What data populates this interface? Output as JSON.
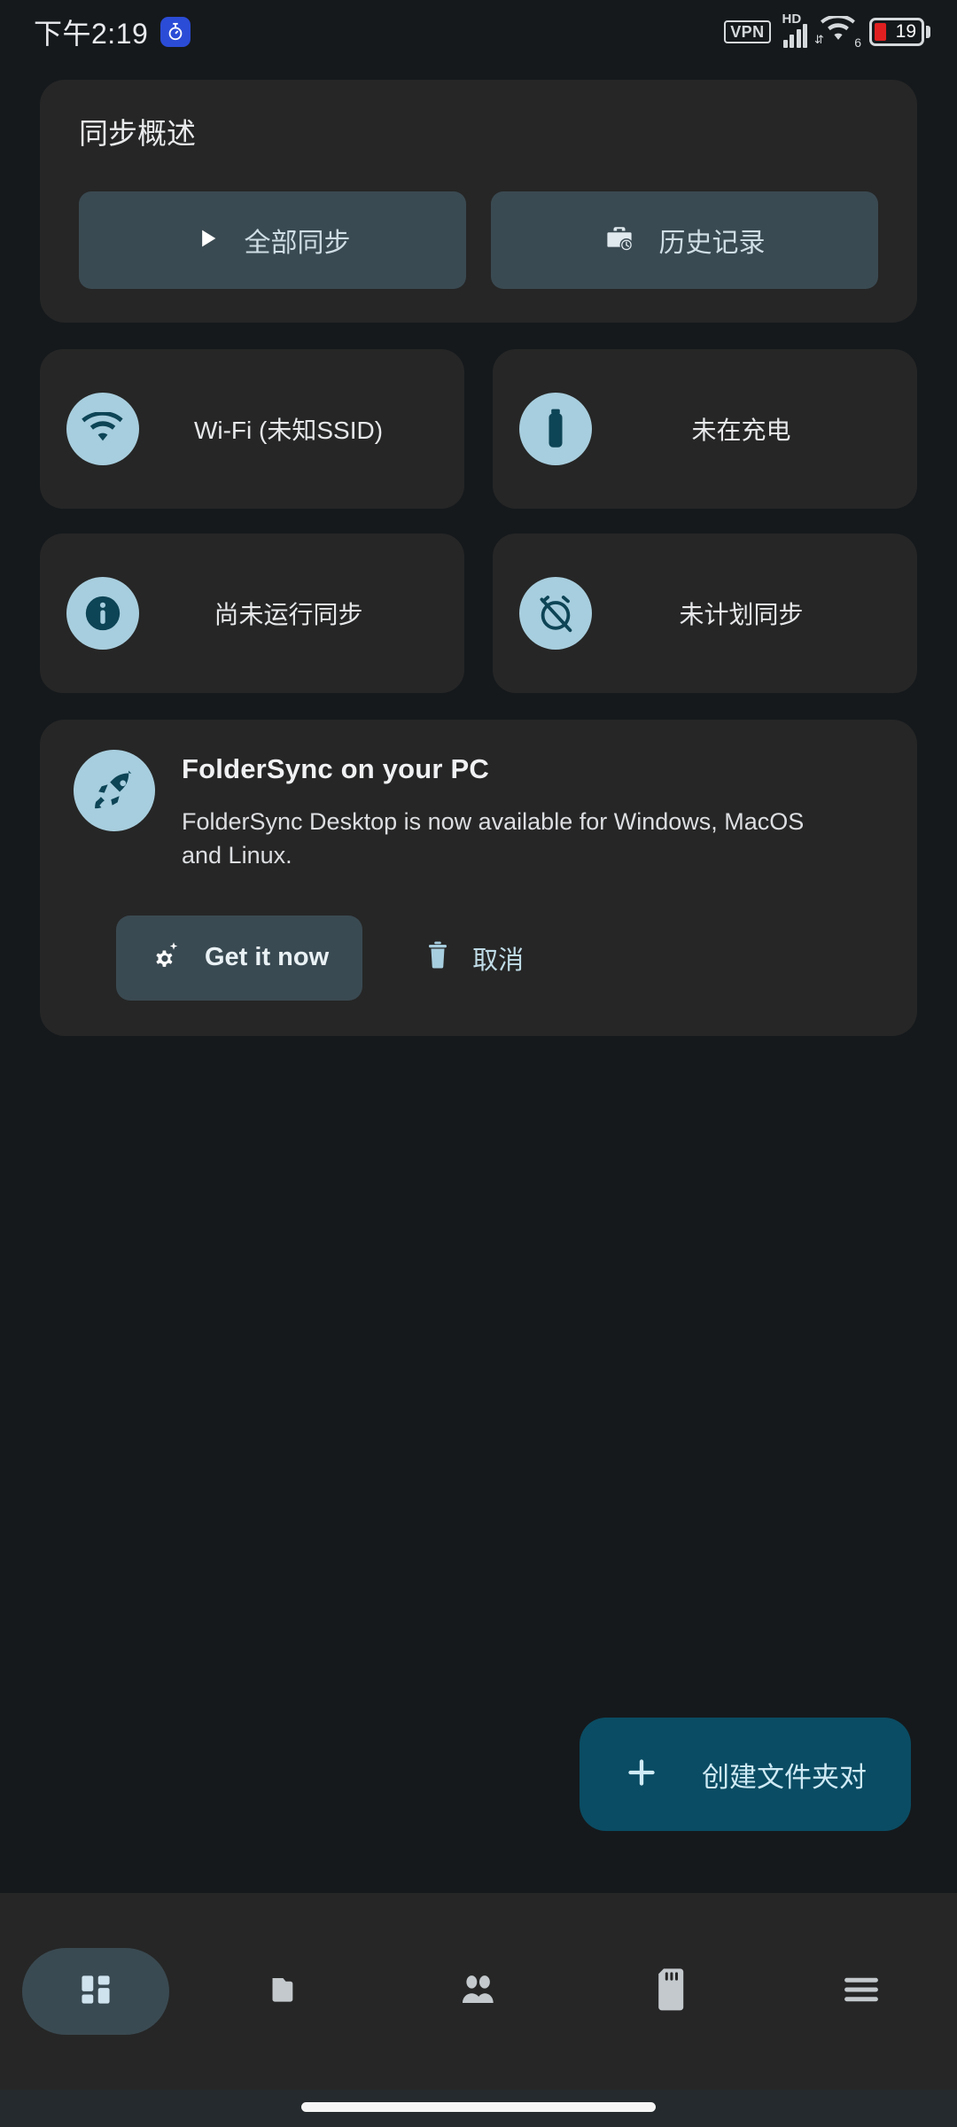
{
  "status_bar": {
    "clock": "下午2:19",
    "notification_icon": "stopwatch-icon",
    "vpn_label": "VPN",
    "hd_label": "HD",
    "wifi_generation": "6",
    "battery_percent": "19"
  },
  "overview": {
    "title": "同步概述",
    "buttons": [
      {
        "label": "全部同步",
        "icon": "play-icon"
      },
      {
        "label": "历史记录",
        "icon": "history-briefcase-icon"
      }
    ]
  },
  "tiles": [
    {
      "label": "Wi-Fi (未知SSID)",
      "icon": "wifi-icon"
    },
    {
      "label": "未在充电",
      "icon": "battery-icon"
    },
    {
      "label": "尚未运行同步",
      "icon": "info-icon"
    },
    {
      "label": "未计划同步",
      "icon": "alarm-off-icon"
    }
  ],
  "promo": {
    "icon": "rocket-icon",
    "title": "FolderSync on your PC",
    "body": "FolderSync Desktop is now available for Windows, MacOS and Linux.",
    "primary_button": {
      "label": "Get it now",
      "icon": "gear-sparkle-icon"
    },
    "cancel_button": {
      "label": "取消",
      "icon": "trash-icon"
    }
  },
  "fab": {
    "label": "创建文件夹对",
    "icon": "plus-icon"
  },
  "bottom_nav": [
    {
      "name": "dashboard",
      "icon": "dashboard-icon",
      "selected": true
    },
    {
      "name": "folderpairs",
      "icon": "folder-icon",
      "selected": false
    },
    {
      "name": "accounts",
      "icon": "people-icon",
      "selected": false
    },
    {
      "name": "storage",
      "icon": "sdcard-icon",
      "selected": false
    },
    {
      "name": "menu",
      "icon": "hamburger-icon",
      "selected": false
    }
  ],
  "colors": {
    "page_background": "#15191c",
    "card_background": "#262626",
    "button_surface": "#3a4a52",
    "accent_fab": "#0a4c63",
    "icon_circle": "#a7cede",
    "icon_glyph": "#0d4456",
    "text_primary": "#e9eaec",
    "battery_low": "#e02020"
  }
}
